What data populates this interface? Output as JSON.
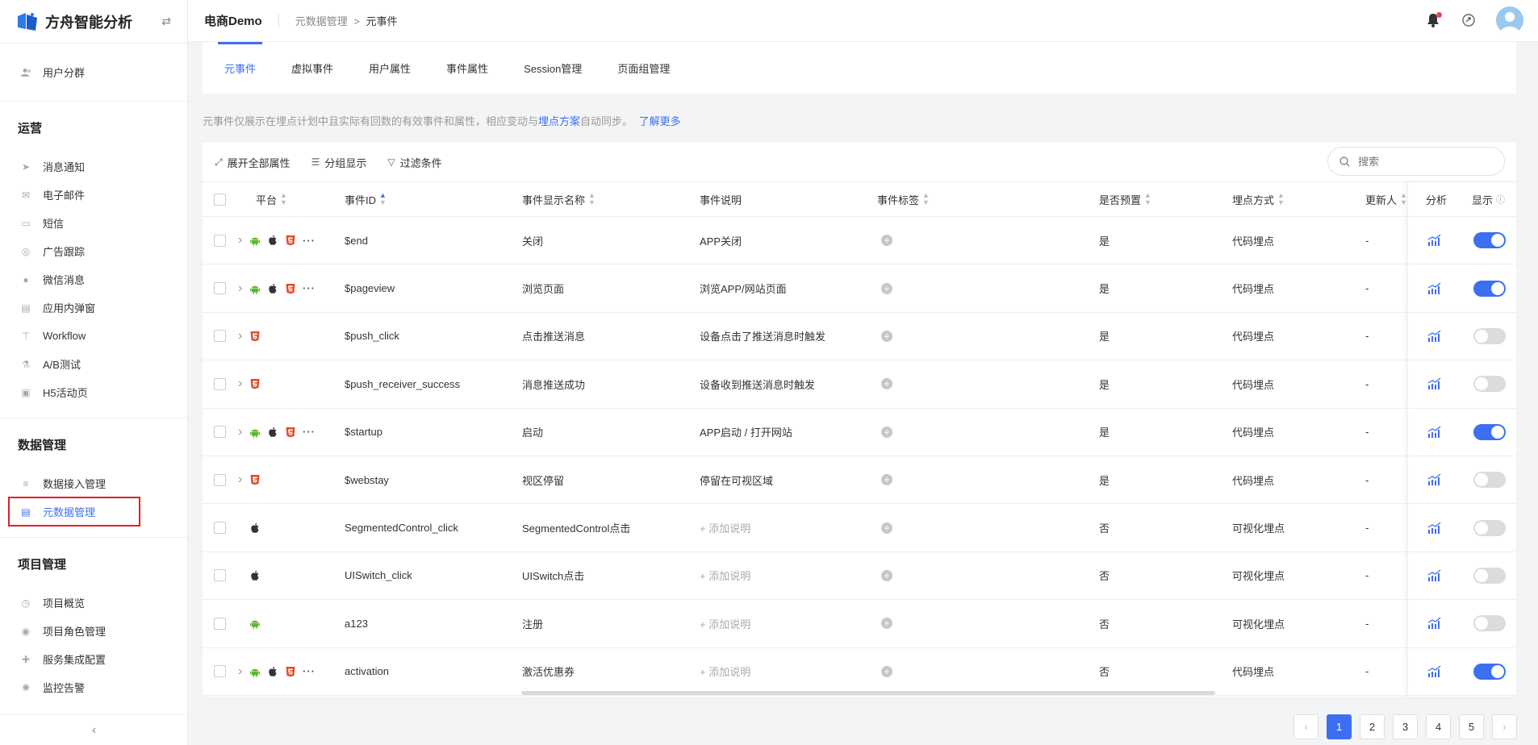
{
  "app": {
    "title": "方舟智能分析"
  },
  "sidebar": {
    "top_item": {
      "label": "用户分群",
      "icon": "users-icon"
    },
    "sections": [
      {
        "title": "运营",
        "items": [
          {
            "label": "消息通知",
            "icon": "send-icon"
          },
          {
            "label": "电子邮件",
            "icon": "mail-icon"
          },
          {
            "label": "短信",
            "icon": "chat-icon"
          },
          {
            "label": "广告跟踪",
            "icon": "target-icon"
          },
          {
            "label": "微信消息",
            "icon": "wechat-icon"
          },
          {
            "label": "应用内弹窗",
            "icon": "popup-icon"
          },
          {
            "label": "Workflow",
            "icon": "workflow-icon"
          },
          {
            "label": "A/B测试",
            "icon": "flask-icon"
          },
          {
            "label": "H5活动页",
            "icon": "h5-icon"
          }
        ]
      },
      {
        "title": "数据管理",
        "items": [
          {
            "label": "数据接入管理",
            "icon": "database-icon"
          },
          {
            "label": "元数据管理",
            "icon": "metadata-icon"
          }
        ]
      },
      {
        "title": "项目管理",
        "items": [
          {
            "label": "项目概览",
            "icon": "overview-icon"
          },
          {
            "label": "项目角色管理",
            "icon": "role-icon"
          },
          {
            "label": "服务集成配置",
            "icon": "puzzle-icon"
          },
          {
            "label": "监控告警",
            "icon": "alarm-icon"
          }
        ]
      }
    ],
    "collapse": "‹"
  },
  "topbar": {
    "project": "电商Demo",
    "breadcrumb": [
      "元数据管理",
      "元事件"
    ],
    "breadcrumb_sep": ">"
  },
  "tabs": [
    "元事件",
    "虚拟事件",
    "用户属性",
    "事件属性",
    "Session管理",
    "页面组管理"
  ],
  "notice": {
    "text1": "元事件仅展示在埋点计划中且实际有回数的有效事件和属性，相应变动与",
    "link1": "埋点方案",
    "text2": "自动同步。",
    "link2": "了解更多"
  },
  "toolbar": {
    "expand": "展开全部属性",
    "group": "分组显示",
    "filter": "过滤条件",
    "search_placeholder": "搜索"
  },
  "table": {
    "headers": {
      "platform": "平台",
      "event_id": "事件ID",
      "display_name": "事件显示名称",
      "description": "事件说明",
      "tags": "事件标签",
      "preset": "是否预置",
      "method": "埋点方式",
      "updater": "更新人",
      "analyze": "分析",
      "show": "显示"
    },
    "rows": [
      {
        "expand": true,
        "platforms": [
          "android",
          "apple",
          "h5"
        ],
        "more": true,
        "event_id": "$end",
        "name": "关闭",
        "desc": "APP关闭",
        "desc_placeholder": false,
        "preset": "是",
        "method": "代码埋点",
        "updater": "-",
        "show": true
      },
      {
        "expand": true,
        "platforms": [
          "android",
          "apple",
          "h5"
        ],
        "more": true,
        "event_id": "$pageview",
        "name": "浏览页面",
        "desc": "浏览APP/网站页面",
        "desc_placeholder": false,
        "preset": "是",
        "method": "代码埋点",
        "updater": "-",
        "show": true
      },
      {
        "expand": true,
        "platforms": [
          "h5"
        ],
        "more": false,
        "event_id": "$push_click",
        "name": "点击推送消息",
        "desc": "设备点击了推送消息时触发",
        "desc_placeholder": false,
        "preset": "是",
        "method": "代码埋点",
        "updater": "-",
        "show": false
      },
      {
        "expand": true,
        "platforms": [
          "h5"
        ],
        "more": false,
        "event_id": "$push_receiver_success",
        "name": "消息推送成功",
        "desc": "设备收到推送消息时触发",
        "desc_placeholder": false,
        "preset": "是",
        "method": "代码埋点",
        "updater": "-",
        "show": false
      },
      {
        "expand": true,
        "platforms": [
          "android",
          "apple",
          "h5"
        ],
        "more": true,
        "event_id": "$startup",
        "name": "启动",
        "desc": "APP启动 / 打开网站",
        "desc_placeholder": false,
        "preset": "是",
        "method": "代码埋点",
        "updater": "-",
        "show": true
      },
      {
        "expand": true,
        "platforms": [
          "h5"
        ],
        "more": false,
        "event_id": "$webstay",
        "name": "视区停留",
        "desc": "停留在可视区域",
        "desc_placeholder": false,
        "preset": "是",
        "method": "代码埋点",
        "updater": "-",
        "show": false
      },
      {
        "expand": false,
        "platforms": [
          "apple"
        ],
        "more": false,
        "event_id": "SegmentedControl_click",
        "name": "SegmentedControl点击",
        "desc": "+ 添加说明",
        "desc_placeholder": true,
        "preset": "否",
        "method": "可视化埋点",
        "updater": "-",
        "show": false
      },
      {
        "expand": false,
        "platforms": [
          "apple"
        ],
        "more": false,
        "event_id": "UISwitch_click",
        "name": "UISwitch点击",
        "desc": "+ 添加说明",
        "desc_placeholder": true,
        "preset": "否",
        "method": "可视化埋点",
        "updater": "-",
        "show": false
      },
      {
        "expand": false,
        "platforms": [
          "android"
        ],
        "more": false,
        "event_id": "a123",
        "name": "注册",
        "desc": "+ 添加说明",
        "desc_placeholder": true,
        "preset": "否",
        "method": "可视化埋点",
        "updater": "-",
        "show": false
      },
      {
        "expand": true,
        "platforms": [
          "android",
          "apple",
          "h5"
        ],
        "more": true,
        "event_id": "activation",
        "name": "激活优惠券",
        "desc": "+ 添加说明",
        "desc_placeholder": true,
        "preset": "否",
        "method": "代码埋点",
        "updater": "-",
        "show": true
      }
    ]
  },
  "pagination": {
    "pages": [
      "1",
      "2",
      "3",
      "4",
      "5"
    ],
    "current": "1",
    "prev": "‹",
    "next": "›"
  },
  "colors": {
    "accent": "#3d6ff2",
    "android": "#5cb82a",
    "h5": "#e34c26",
    "highlight_box": "#e0202a"
  }
}
